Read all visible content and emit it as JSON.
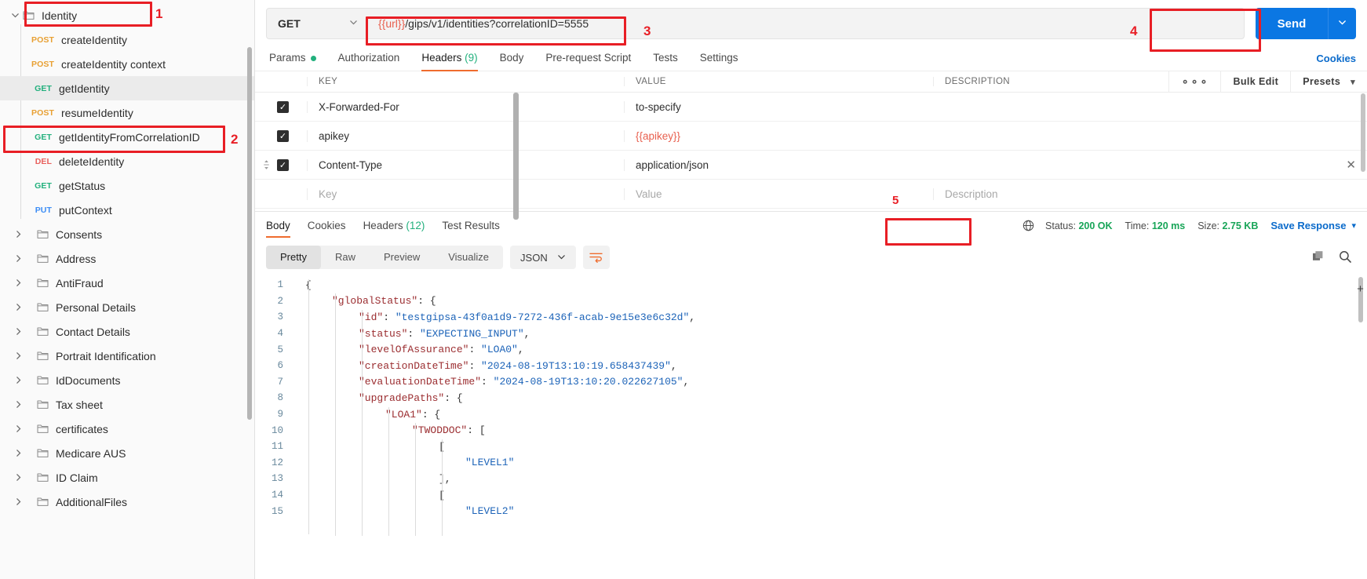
{
  "sidebar": {
    "root": {
      "label": "Identity",
      "icon": "folder-icon",
      "chevron": "chevron-down-icon"
    },
    "requests": [
      {
        "method": "POST",
        "name": "createIdentity"
      },
      {
        "method": "POST",
        "name": "createIdentity context"
      },
      {
        "method": "GET",
        "name": "getIdentity"
      },
      {
        "method": "POST",
        "name": "resumeIdentity"
      },
      {
        "method": "GET",
        "name": "getIdentityFromCorrelationID"
      },
      {
        "method": "DEL",
        "name": "deleteIdentity"
      },
      {
        "method": "GET",
        "name": "getStatus"
      },
      {
        "method": "PUT",
        "name": "putContext"
      }
    ],
    "folders": [
      {
        "label": "Consents"
      },
      {
        "label": "Address"
      },
      {
        "label": "AntiFraud"
      },
      {
        "label": "Personal Details"
      },
      {
        "label": "Contact Details"
      },
      {
        "label": "Portrait Identification"
      },
      {
        "label": "IdDocuments"
      },
      {
        "label": "Tax sheet"
      },
      {
        "label": "certificates"
      },
      {
        "label": "Medicare AUS"
      },
      {
        "label": "ID Claim"
      },
      {
        "label": "AdditionalFiles"
      }
    ]
  },
  "request": {
    "method": "GET",
    "url_variable": "{{url}}",
    "url_rest": "/gips/v1/identities?correlationID=5555",
    "url_full": "{{url}}/gips/v1/identities?correlationID=5555",
    "send_label": "Send",
    "cookies_label": "Cookies",
    "tabs": [
      {
        "label": "Params",
        "badge": "dot",
        "active": false
      },
      {
        "label": "Authorization",
        "active": false
      },
      {
        "label": "Headers",
        "count": "(9)",
        "active": true
      },
      {
        "label": "Body",
        "active": false
      },
      {
        "label": "Pre-request Script",
        "active": false
      },
      {
        "label": "Tests",
        "active": false
      },
      {
        "label": "Settings",
        "active": false
      }
    ]
  },
  "headers_table": {
    "columns": {
      "key": "KEY",
      "value": "VALUE",
      "description": "DESCRIPTION"
    },
    "tools": {
      "more": "⚬⚬⚬",
      "bulk_edit": "Bulk Edit",
      "presets": "Presets"
    },
    "rows": [
      {
        "checked": true,
        "key": "X-Forwarded-For",
        "value": "to-specify",
        "value_variable": false,
        "description": ""
      },
      {
        "checked": true,
        "key": "apikey",
        "value": "{{apikey}}",
        "value_variable": true,
        "description": ""
      },
      {
        "checked": true,
        "key": "Content-Type",
        "value": "application/json",
        "value_variable": false,
        "description": ""
      }
    ],
    "new_row": {
      "key_placeholder": "Key",
      "value_placeholder": "Value",
      "description_placeholder": "Description"
    }
  },
  "response": {
    "tabs": [
      {
        "label": "Body",
        "active": true
      },
      {
        "label": "Cookies",
        "active": false
      },
      {
        "label": "Headers",
        "count": "(12)",
        "active": false
      },
      {
        "label": "Test Results",
        "active": false
      }
    ],
    "status_label": "Status:",
    "status_value": "200 OK",
    "time_label": "Time:",
    "time_value": "120 ms",
    "size_label": "Size:",
    "size_value": "2.75 KB",
    "save_response": "Save Response",
    "view_modes": [
      {
        "label": "Pretty",
        "active": true
      },
      {
        "label": "Raw",
        "active": false
      },
      {
        "label": "Preview",
        "active": false
      },
      {
        "label": "Visualize",
        "active": false
      }
    ],
    "format": "JSON",
    "body_lines": [
      {
        "n": "1",
        "indent": 0,
        "parts": [
          [
            "p",
            "{"
          ]
        ]
      },
      {
        "n": "2",
        "indent": 1,
        "parts": [
          [
            "k",
            "\"globalStatus\""
          ],
          [
            "p",
            ": {"
          ]
        ]
      },
      {
        "n": "3",
        "indent": 2,
        "parts": [
          [
            "k",
            "\"id\""
          ],
          [
            "p",
            ": "
          ],
          [
            "s",
            "\"testgipsa-43f0a1d9-7272-436f-acab-9e15e3e6c32d\""
          ],
          [
            "p",
            ","
          ]
        ]
      },
      {
        "n": "4",
        "indent": 2,
        "parts": [
          [
            "k",
            "\"status\""
          ],
          [
            "p",
            ": "
          ],
          [
            "s",
            "\"EXPECTING_INPUT\""
          ],
          [
            "p",
            ","
          ]
        ]
      },
      {
        "n": "5",
        "indent": 2,
        "parts": [
          [
            "k",
            "\"levelOfAssurance\""
          ],
          [
            "p",
            ": "
          ],
          [
            "s",
            "\"LOA0\""
          ],
          [
            "p",
            ","
          ]
        ]
      },
      {
        "n": "6",
        "indent": 2,
        "parts": [
          [
            "k",
            "\"creationDateTime\""
          ],
          [
            "p",
            ": "
          ],
          [
            "s",
            "\"2024-08-19T13:10:19.658437439\""
          ],
          [
            "p",
            ","
          ]
        ]
      },
      {
        "n": "7",
        "indent": 2,
        "parts": [
          [
            "k",
            "\"evaluationDateTime\""
          ],
          [
            "p",
            ": "
          ],
          [
            "s",
            "\"2024-08-19T13:10:20.022627105\""
          ],
          [
            "p",
            ","
          ]
        ]
      },
      {
        "n": "8",
        "indent": 2,
        "parts": [
          [
            "k",
            "\"upgradePaths\""
          ],
          [
            "p",
            ": {"
          ]
        ]
      },
      {
        "n": "9",
        "indent": 3,
        "parts": [
          [
            "k",
            "\"LOA1\""
          ],
          [
            "p",
            ": {"
          ]
        ]
      },
      {
        "n": "10",
        "indent": 4,
        "parts": [
          [
            "k",
            "\"TWODDOC\""
          ],
          [
            "p",
            ": ["
          ]
        ]
      },
      {
        "n": "11",
        "indent": 5,
        "parts": [
          [
            "p",
            "["
          ]
        ]
      },
      {
        "n": "12",
        "indent": 6,
        "parts": [
          [
            "s",
            "\"LEVEL1\""
          ]
        ]
      },
      {
        "n": "13",
        "indent": 5,
        "parts": [
          [
            "p",
            "],"
          ]
        ]
      },
      {
        "n": "14",
        "indent": 5,
        "parts": [
          [
            "p",
            "["
          ]
        ]
      },
      {
        "n": "15",
        "indent": 6,
        "parts": [
          [
            "s",
            "\"LEVEL2\""
          ]
        ]
      }
    ]
  },
  "annotations": [
    {
      "id": "1",
      "target": "sidebar-root-folder"
    },
    {
      "id": "2",
      "target": "sidebar-request-getIdentityFromCorrelationID"
    },
    {
      "id": "3",
      "target": "url-input"
    },
    {
      "id": "4",
      "target": "send-button"
    },
    {
      "id": "5",
      "target": "description-cell"
    }
  ],
  "colors": {
    "accent_orange": "#ef6c2e",
    "send_blue": "#0b77e3",
    "status_green": "#18a558",
    "annotation_red": "#e81e25",
    "variable_red": "#e8604f"
  }
}
